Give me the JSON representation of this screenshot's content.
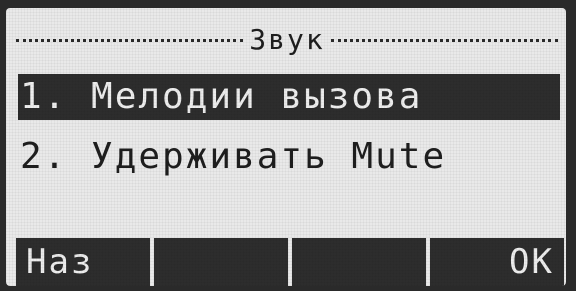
{
  "screen": {
    "title": "Звук"
  },
  "menu": {
    "items": [
      {
        "label": "1. Мелодии вызова",
        "selected": true
      },
      {
        "label": "2. Удерживать Mute",
        "selected": false
      }
    ]
  },
  "softkeys": [
    {
      "label": "Наз"
    },
    {
      "label": ""
    },
    {
      "label": ""
    },
    {
      "label": "OK"
    }
  ]
}
